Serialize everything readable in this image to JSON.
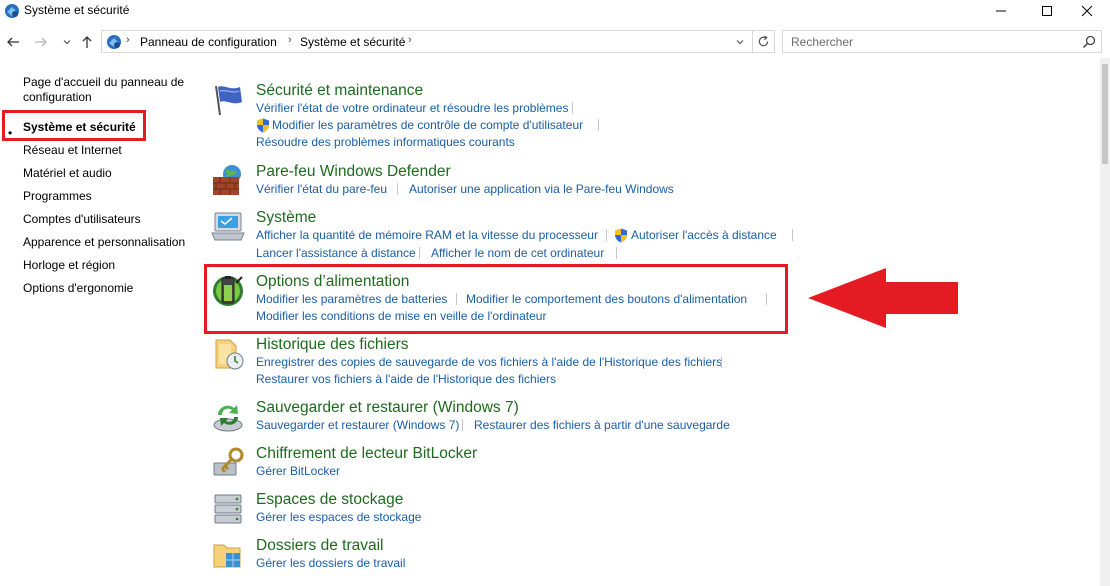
{
  "window": {
    "title": "Système et sécurité"
  },
  "address": {
    "crumbs": [
      "Panneau de configuration",
      "Système et sécurité"
    ],
    "search_placeholder": "Rechercher"
  },
  "leftnav": {
    "items": [
      {
        "label": "Page d'accueil du panneau de"
      },
      {
        "label": "configuration"
      },
      {
        "label": "Système et sécurité"
      },
      {
        "label": "Réseau et Internet"
      },
      {
        "label": "Matériel et audio"
      },
      {
        "label": "Programmes"
      },
      {
        "label": "Comptes d'utilisateurs"
      },
      {
        "label": "Apparence et personnalisation"
      },
      {
        "label": "Horloge et région"
      },
      {
        "label": "Options d'ergonomie"
      }
    ],
    "bullet": "•"
  },
  "sections": [
    {
      "title": "Sécurité et maintenance",
      "links": [
        "Vérifier l'état de votre ordinateur et résoudre les problèmes",
        "Modifier les paramètres de contrôle de compte d'utilisateur",
        "Résoudre des problèmes informatiques courants"
      ]
    },
    {
      "title": "Pare-feu Windows Defender",
      "links": [
        "Vérifier l'état du pare-feu",
        "Autoriser une application via le Pare-feu Windows"
      ]
    },
    {
      "title": "Système",
      "links": [
        "Afficher la quantité de mémoire RAM et la vitesse du processeur",
        "Autoriser l'accès à distance",
        "Lancer l'assistance à distance",
        "Afficher le nom de cet ordinateur"
      ]
    },
    {
      "title": "Options d’alimentation",
      "links": [
        "Modifier les paramètres de batteries",
        "Modifier le comportement des boutons d'alimentation",
        "Modifier les conditions de mise en veille de l'ordinateur"
      ]
    },
    {
      "title": "Historique des fichiers",
      "links": [
        "Enregistrer des copies de sauvegarde de vos fichiers à l'aide de l'Historique des fichiers",
        "Restaurer vos fichiers à l'aide de l'Historique des fichiers"
      ]
    },
    {
      "title": "Sauvegarder et restaurer (Windows 7)",
      "links": [
        "Sauvegarder et restaurer (Windows 7)",
        "Restaurer des fichiers à partir d'une sauvegarde"
      ]
    },
    {
      "title": "Chiffrement de lecteur BitLocker",
      "links": [
        "Gérer BitLocker"
      ]
    },
    {
      "title": "Espaces de stockage",
      "links": [
        "Gérer les espaces de stockage"
      ]
    },
    {
      "title": "Dossiers de travail",
      "links": [
        "Gérer les dossiers de travail"
      ]
    }
  ],
  "colors": {
    "title_green": "#1e6a1e",
    "link_blue": "#1a5ea8",
    "highlight_red": "#e41b23"
  },
  "icons": {
    "app": "control-panel-icon",
    "back": "back-arrow-icon",
    "forward": "forward-arrow-icon",
    "recent": "chevron-down-icon",
    "up": "up-arrow-icon",
    "search": "search-icon",
    "refresh": "refresh-icon",
    "uac": "uac-shield-icon"
  }
}
